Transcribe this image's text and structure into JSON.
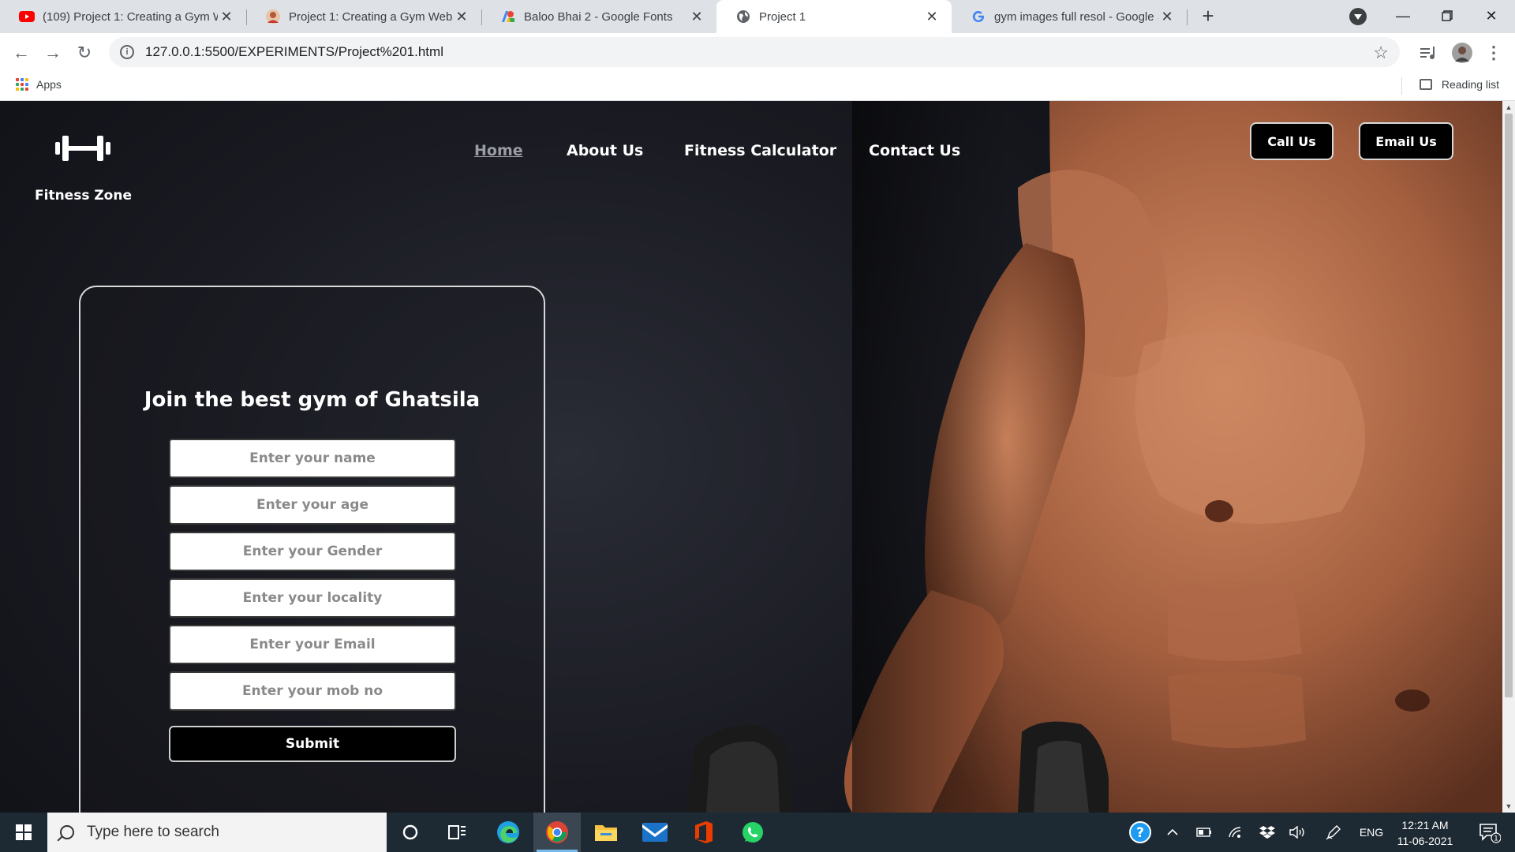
{
  "browser": {
    "tabs": [
      {
        "title": "(109) Project 1: Creating a Gym W",
        "icon": "youtube-icon"
      },
      {
        "title": "Project 1: Creating a Gym Websit",
        "icon": "avatar-icon"
      },
      {
        "title": "Baloo Bhai 2 - Google Fonts",
        "icon": "google-fonts-icon"
      },
      {
        "title": "Project 1",
        "icon": "globe-icon",
        "active": true
      },
      {
        "title": "gym images full resol - Google S",
        "icon": "google-icon"
      }
    ],
    "url": "127.0.0.1:5500/EXPERIMENTS/Project%201.html",
    "bookmarks": {
      "apps_label": "Apps",
      "reading_list_label": "Reading list"
    }
  },
  "page": {
    "brand": "Fitness Zone",
    "nav": {
      "home": "Home",
      "about": "About Us",
      "calculator": "Fitness Calculator",
      "contact": "Contact Us"
    },
    "buttons": {
      "call": "Call Us",
      "email": "Email Us"
    },
    "form": {
      "title": "Join the best gym of Ghatsila",
      "fields": {
        "name": "Enter your name",
        "age": "Enter your age",
        "gender": "Enter your Gender",
        "locality": "Enter your locality",
        "email": "Enter your Email",
        "mobile": "Enter your mob no"
      },
      "submit": "Submit"
    }
  },
  "taskbar": {
    "search_placeholder": "Type here to search",
    "language": "ENG",
    "time": "12:21 AM",
    "date": "11-06-2021",
    "notification_count": "1"
  },
  "colors": {
    "nav_active": "#9a9ca6",
    "page_bg": "#1a1b22",
    "skin": "#b06a48",
    "taskbar": "#1e2a33"
  }
}
